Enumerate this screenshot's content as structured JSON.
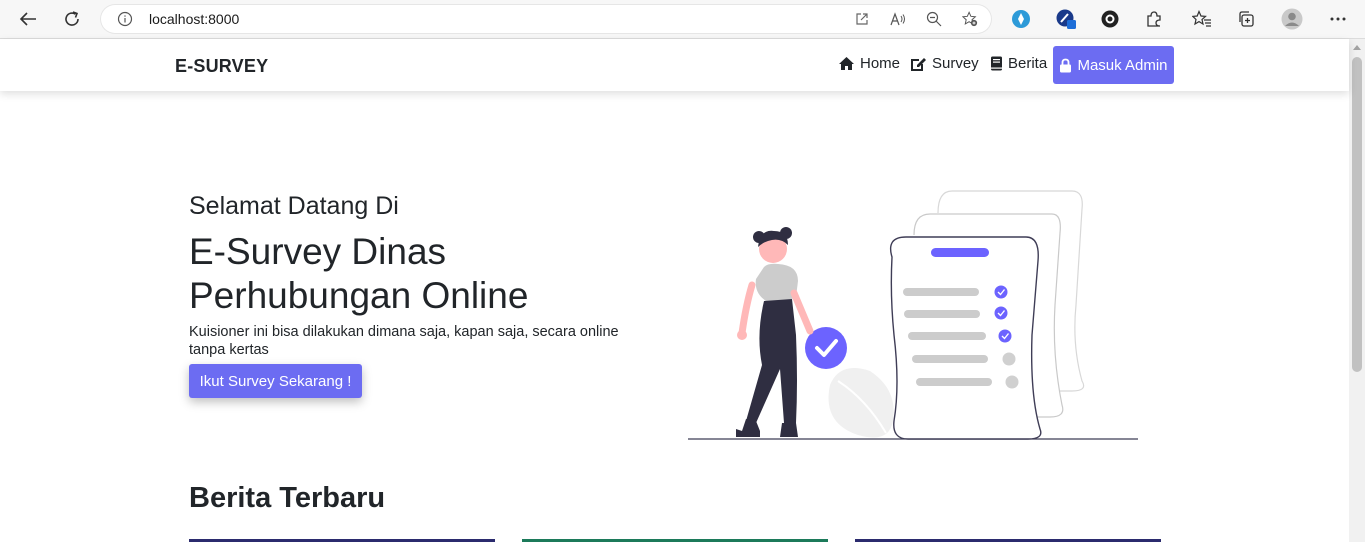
{
  "browser": {
    "url": "localhost:8000"
  },
  "navbar": {
    "brand": "E-SURVEY",
    "links": [
      {
        "label": "Home",
        "icon": "home-icon"
      },
      {
        "label": "Survey",
        "icon": "edit-icon"
      },
      {
        "label": "Berita",
        "icon": "book-icon"
      }
    ],
    "admin_button": {
      "label": "Masuk Admin",
      "icon": "lock-icon"
    }
  },
  "hero": {
    "subtitle": "Selamat Datang Di",
    "title": "E-Survey Dinas Perhubungan Online",
    "description": "Kuisioner ini bisa dilakukan dimana saja, kapan saja, secara online tanpa kertas",
    "cta": "Ikut Survey Sekarang !"
  },
  "news": {
    "heading": "Berita Terbaru",
    "card_colors": [
      "#2b2b6e",
      "#1c7a5a",
      "#2b2b6e"
    ]
  },
  "colors": {
    "accent": "#6c6cf2",
    "text": "#212529"
  }
}
